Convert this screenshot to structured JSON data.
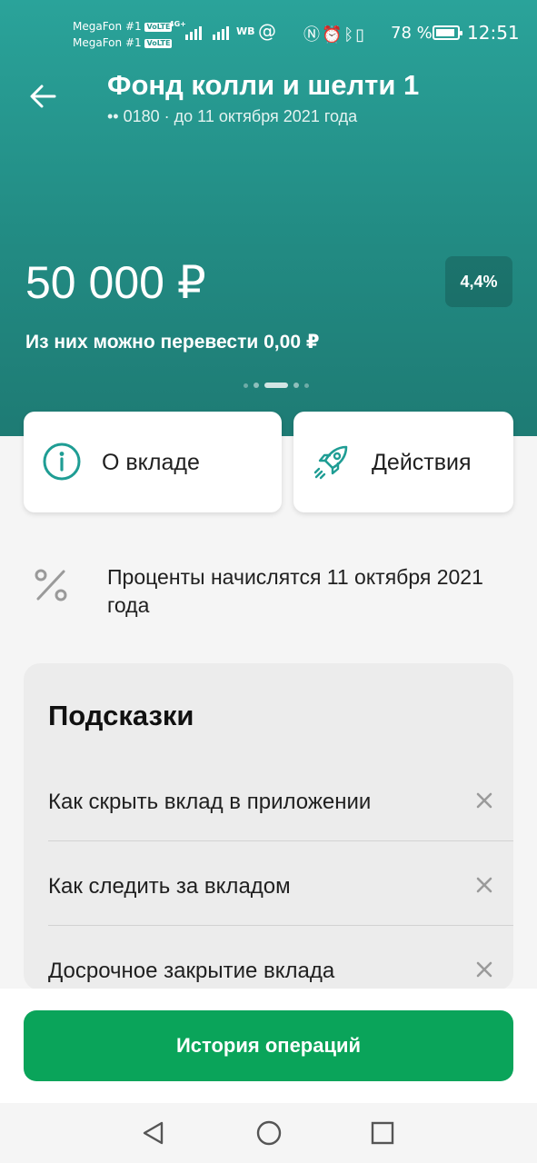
{
  "status_bar": {
    "carrier1": "MegaFon #1",
    "carrier2": "MegaFon #1",
    "volte": "VoLTE",
    "network": "4G+",
    "wb": "WB",
    "at": "@",
    "battery_percent": "78 %",
    "time": "12:51"
  },
  "header": {
    "title": "Фонд колли и шелти 1",
    "subtitle": "•• 0180 · до 11 октября 2021 года",
    "amount": "50 000 ₽",
    "rate": "4,4%",
    "available": "Из них можно перевести 0,00 ₽",
    "page_indicator": {
      "pages": 5,
      "active": 3
    }
  },
  "cards": {
    "about": {
      "label": "О вкладе",
      "icon": "info-icon"
    },
    "actions": {
      "label": "Действия",
      "icon": "rocket-icon"
    }
  },
  "interest": {
    "icon": "percent-icon",
    "text": "Проценты начислятся 11 октября 2021 года"
  },
  "tips": {
    "title": "Подсказки",
    "items": [
      {
        "label": "Как скрыть вклад в приложении"
      },
      {
        "label": "Как следить за вкладом"
      },
      {
        "label": "Досрочное закрытие вклада"
      }
    ]
  },
  "history_button": {
    "label": "История операций"
  },
  "colors": {
    "header_gradient_top": "#2aa39a",
    "header_gradient_bottom": "#1e7b74",
    "accent_green": "#0aa45a",
    "icon_teal": "#1f9d94"
  }
}
